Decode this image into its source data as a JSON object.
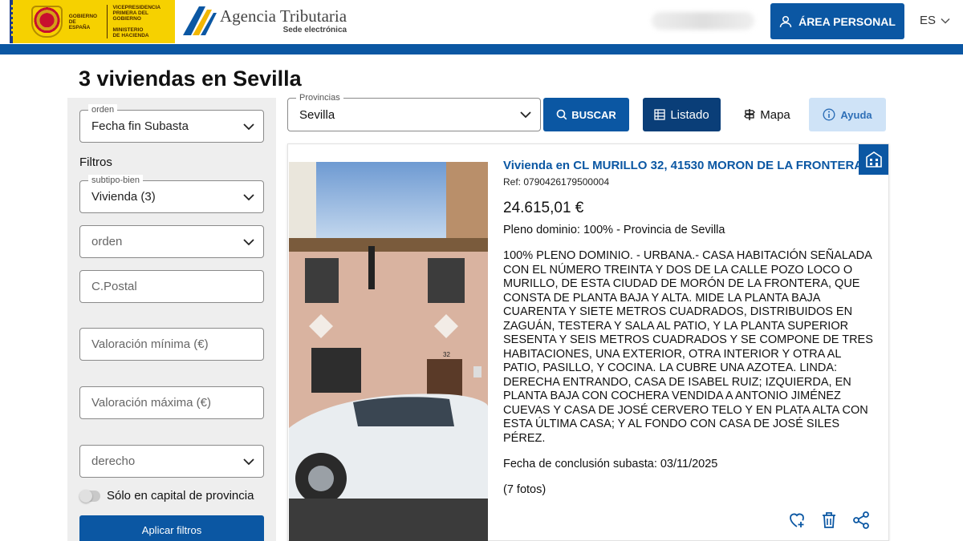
{
  "header": {
    "gov_lines_left": [
      "GOBIERNO",
      "DE ESPAÑA"
    ],
    "gov_lines_right": [
      "VICEPRESIDENCIA",
      "PRIMERA DEL GOBIERNO",
      "",
      "MINISTERIO",
      "DE HACIENDA"
    ],
    "agency_name": "Agencia Tributaria",
    "agency_sub": "Sede electrónica",
    "area_personal_label": "ÁREA PERSONAL",
    "language": "ES",
    "accent_color": "#0b57a3"
  },
  "page": {
    "title": "3 viviendas en Sevilla"
  },
  "sidebar": {
    "orden_label": "orden",
    "orden_value": "Fecha fin Subasta",
    "filtros_heading": "Filtros",
    "subtipo_label": "subtipo-bien",
    "subtipo_value": "Vivienda (3)",
    "orden2_placeholder": "orden",
    "cpostal_placeholder": "C.Postal",
    "valor_min_placeholder": "Valoración mínima (€)",
    "valor_max_placeholder": "Valoración máxima (€)",
    "derecho_placeholder": "derecho",
    "capital_toggle_label": "Sólo en capital de provincia",
    "apply_label": "Aplicar filtros"
  },
  "toolbar": {
    "provincias_label": "Provincias",
    "provincias_value": "Sevilla",
    "buscar_label": "BUSCAR",
    "listado_label": "Listado",
    "mapa_label": "Mapa",
    "ayuda_label": "Ayuda"
  },
  "listing": {
    "title": "Vivienda en CL MURILLO 32, 41530 MORON DE LA FRONTERA",
    "ref": "Ref: 0790426179500004",
    "price": "24.615,01 €",
    "ownership": "Pleno dominio: 100% - Provincia de Sevilla",
    "description": "100% PLENO DOMINIO. - URBANA.- CASA HABITACIÓN SEÑALADA CON EL NÚMERO TREINTA Y DOS DE LA CALLE POZO LOCO O MURILLO, DE ESTA CIUDAD DE MORÓN DE LA FRONTERA, QUE CONSTA DE PLANTA BAJA Y ALTA. MIDE LA PLANTA BAJA CUARENTA Y SIETE METROS CUADRADOS, DISTRIBUIDOS EN ZAGUÁN, TESTERA Y SALA AL PATIO, Y LA PLANTA SUPERIOR SESENTA Y SEIS METROS CUADRADOS Y SE COMPONE DE TRES HABITACIONES, UNA EXTERIOR, OTRA INTERIOR Y OTRA AL PATIO, PASILLO, Y COCINA. LA CUBRE UNA AZOTEA. LINDA: DERECHA ENTRANDO, CASA DE ISABEL RUIZ; IZQUIERDA, EN PLANTA BAJA CON COCHERA VENDIDA A ANTONIO JIMÉNEZ CUEVAS Y CASA DE JOSÉ CERVERO TELO Y EN PLATA ALTA CON ESTA ÚLTIMA CASA; Y AL FONDO CON CASA DE JOSÉ SILES PÉREZ.",
    "end_date": "Fecha de conclusión subasta: 03/11/2025",
    "photo_count": "(7 fotos)",
    "house_number": "32"
  }
}
